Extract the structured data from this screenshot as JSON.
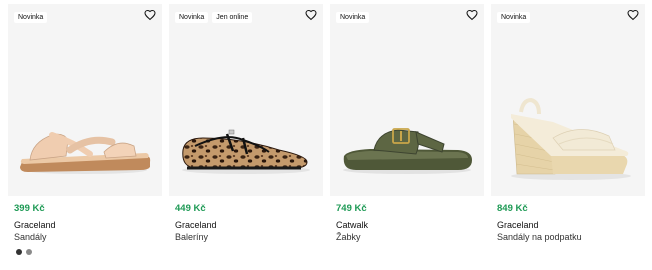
{
  "products": [
    {
      "badges": [
        "Novinka"
      ],
      "price": "399 Kč",
      "brand": "Graceland",
      "category": "Sandály",
      "image": "beige-sandal",
      "color_dots": [
        "#333333",
        "#8a8a8a"
      ]
    },
    {
      "badges": [
        "Novinka",
        "Jen online"
      ],
      "price": "449 Kč",
      "brand": "Graceland",
      "category": "Baleríny",
      "image": "leopard-ballerina"
    },
    {
      "badges": [
        "Novinka"
      ],
      "price": "749 Kč",
      "brand": "Catwalk",
      "category": "Žabky",
      "image": "olive-flip-flop"
    },
    {
      "badges": [
        "Novinka"
      ],
      "price": "849 Kč",
      "brand": "Graceland",
      "category": "Sandály na podpatku",
      "image": "cream-wedge-sandal"
    }
  ],
  "icons": {
    "favorite": "heart-icon"
  },
  "colors": {
    "price": "#1e9a55",
    "image_bg": "#f5f5f5"
  }
}
